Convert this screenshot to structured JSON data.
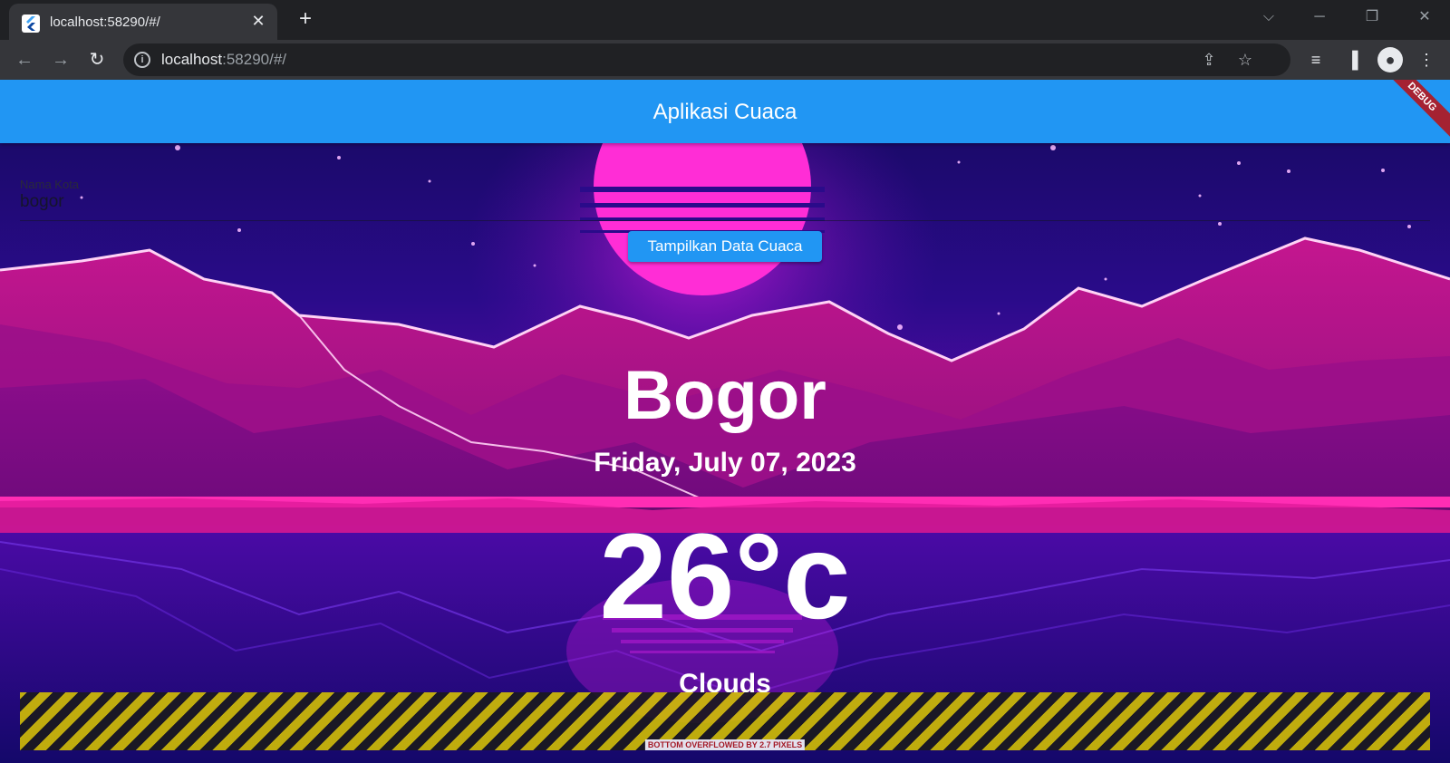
{
  "browser": {
    "tab_title": "localhost:58290/#/",
    "tab_close": "✕",
    "new_tab": "+",
    "url_host": "localhost",
    "url_path": ":58290/#/"
  },
  "app": {
    "title": "Aplikasi Cuaca",
    "debug_banner": "DEBUG",
    "city_field": {
      "label": "Nama Kota",
      "value": "bogor"
    },
    "show_button": "Tampilkan Data Cuaca",
    "weather": {
      "city": "Bogor",
      "date": "Friday, July 07, 2023",
      "temperature": "26°c",
      "description": "Clouds"
    },
    "overflow_message": "BOTTOM OVERFLOWED BY 2.7 PIXELS"
  },
  "colors": {
    "appbar": "#2196f3",
    "debug": "#a52232",
    "sun": "#ff2dd6"
  }
}
